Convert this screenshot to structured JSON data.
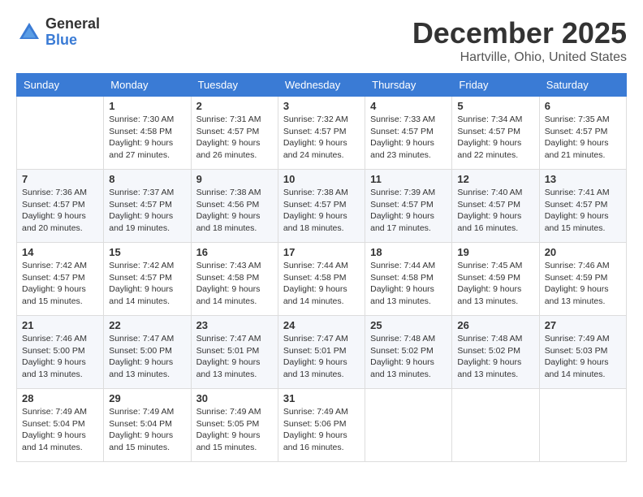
{
  "header": {
    "logo_general": "General",
    "logo_blue": "Blue",
    "title": "December 2025",
    "location": "Hartville, Ohio, United States"
  },
  "days_of_week": [
    "Sunday",
    "Monday",
    "Tuesday",
    "Wednesday",
    "Thursday",
    "Friday",
    "Saturday"
  ],
  "weeks": [
    [
      {
        "day": "",
        "sunrise": "",
        "sunset": "",
        "daylight": ""
      },
      {
        "day": "1",
        "sunrise": "Sunrise: 7:30 AM",
        "sunset": "Sunset: 4:58 PM",
        "daylight": "Daylight: 9 hours and 27 minutes."
      },
      {
        "day": "2",
        "sunrise": "Sunrise: 7:31 AM",
        "sunset": "Sunset: 4:57 PM",
        "daylight": "Daylight: 9 hours and 26 minutes."
      },
      {
        "day": "3",
        "sunrise": "Sunrise: 7:32 AM",
        "sunset": "Sunset: 4:57 PM",
        "daylight": "Daylight: 9 hours and 24 minutes."
      },
      {
        "day": "4",
        "sunrise": "Sunrise: 7:33 AM",
        "sunset": "Sunset: 4:57 PM",
        "daylight": "Daylight: 9 hours and 23 minutes."
      },
      {
        "day": "5",
        "sunrise": "Sunrise: 7:34 AM",
        "sunset": "Sunset: 4:57 PM",
        "daylight": "Daylight: 9 hours and 22 minutes."
      },
      {
        "day": "6",
        "sunrise": "Sunrise: 7:35 AM",
        "sunset": "Sunset: 4:57 PM",
        "daylight": "Daylight: 9 hours and 21 minutes."
      }
    ],
    [
      {
        "day": "7",
        "sunrise": "Sunrise: 7:36 AM",
        "sunset": "Sunset: 4:57 PM",
        "daylight": "Daylight: 9 hours and 20 minutes."
      },
      {
        "day": "8",
        "sunrise": "Sunrise: 7:37 AM",
        "sunset": "Sunset: 4:57 PM",
        "daylight": "Daylight: 9 hours and 19 minutes."
      },
      {
        "day": "9",
        "sunrise": "Sunrise: 7:38 AM",
        "sunset": "Sunset: 4:56 PM",
        "daylight": "Daylight: 9 hours and 18 minutes."
      },
      {
        "day": "10",
        "sunrise": "Sunrise: 7:38 AM",
        "sunset": "Sunset: 4:57 PM",
        "daylight": "Daylight: 9 hours and 18 minutes."
      },
      {
        "day": "11",
        "sunrise": "Sunrise: 7:39 AM",
        "sunset": "Sunset: 4:57 PM",
        "daylight": "Daylight: 9 hours and 17 minutes."
      },
      {
        "day": "12",
        "sunrise": "Sunrise: 7:40 AM",
        "sunset": "Sunset: 4:57 PM",
        "daylight": "Daylight: 9 hours and 16 minutes."
      },
      {
        "day": "13",
        "sunrise": "Sunrise: 7:41 AM",
        "sunset": "Sunset: 4:57 PM",
        "daylight": "Daylight: 9 hours and 15 minutes."
      }
    ],
    [
      {
        "day": "14",
        "sunrise": "Sunrise: 7:42 AM",
        "sunset": "Sunset: 4:57 PM",
        "daylight": "Daylight: 9 hours and 15 minutes."
      },
      {
        "day": "15",
        "sunrise": "Sunrise: 7:42 AM",
        "sunset": "Sunset: 4:57 PM",
        "daylight": "Daylight: 9 hours and 14 minutes."
      },
      {
        "day": "16",
        "sunrise": "Sunrise: 7:43 AM",
        "sunset": "Sunset: 4:58 PM",
        "daylight": "Daylight: 9 hours and 14 minutes."
      },
      {
        "day": "17",
        "sunrise": "Sunrise: 7:44 AM",
        "sunset": "Sunset: 4:58 PM",
        "daylight": "Daylight: 9 hours and 14 minutes."
      },
      {
        "day": "18",
        "sunrise": "Sunrise: 7:44 AM",
        "sunset": "Sunset: 4:58 PM",
        "daylight": "Daylight: 9 hours and 13 minutes."
      },
      {
        "day": "19",
        "sunrise": "Sunrise: 7:45 AM",
        "sunset": "Sunset: 4:59 PM",
        "daylight": "Daylight: 9 hours and 13 minutes."
      },
      {
        "day": "20",
        "sunrise": "Sunrise: 7:46 AM",
        "sunset": "Sunset: 4:59 PM",
        "daylight": "Daylight: 9 hours and 13 minutes."
      }
    ],
    [
      {
        "day": "21",
        "sunrise": "Sunrise: 7:46 AM",
        "sunset": "Sunset: 5:00 PM",
        "daylight": "Daylight: 9 hours and 13 minutes."
      },
      {
        "day": "22",
        "sunrise": "Sunrise: 7:47 AM",
        "sunset": "Sunset: 5:00 PM",
        "daylight": "Daylight: 9 hours and 13 minutes."
      },
      {
        "day": "23",
        "sunrise": "Sunrise: 7:47 AM",
        "sunset": "Sunset: 5:01 PM",
        "daylight": "Daylight: 9 hours and 13 minutes."
      },
      {
        "day": "24",
        "sunrise": "Sunrise: 7:47 AM",
        "sunset": "Sunset: 5:01 PM",
        "daylight": "Daylight: 9 hours and 13 minutes."
      },
      {
        "day": "25",
        "sunrise": "Sunrise: 7:48 AM",
        "sunset": "Sunset: 5:02 PM",
        "daylight": "Daylight: 9 hours and 13 minutes."
      },
      {
        "day": "26",
        "sunrise": "Sunrise: 7:48 AM",
        "sunset": "Sunset: 5:02 PM",
        "daylight": "Daylight: 9 hours and 13 minutes."
      },
      {
        "day": "27",
        "sunrise": "Sunrise: 7:49 AM",
        "sunset": "Sunset: 5:03 PM",
        "daylight": "Daylight: 9 hours and 14 minutes."
      }
    ],
    [
      {
        "day": "28",
        "sunrise": "Sunrise: 7:49 AM",
        "sunset": "Sunset: 5:04 PM",
        "daylight": "Daylight: 9 hours and 14 minutes."
      },
      {
        "day": "29",
        "sunrise": "Sunrise: 7:49 AM",
        "sunset": "Sunset: 5:04 PM",
        "daylight": "Daylight: 9 hours and 15 minutes."
      },
      {
        "day": "30",
        "sunrise": "Sunrise: 7:49 AM",
        "sunset": "Sunset: 5:05 PM",
        "daylight": "Daylight: 9 hours and 15 minutes."
      },
      {
        "day": "31",
        "sunrise": "Sunrise: 7:49 AM",
        "sunset": "Sunset: 5:06 PM",
        "daylight": "Daylight: 9 hours and 16 minutes."
      },
      {
        "day": "",
        "sunrise": "",
        "sunset": "",
        "daylight": ""
      },
      {
        "day": "",
        "sunrise": "",
        "sunset": "",
        "daylight": ""
      },
      {
        "day": "",
        "sunrise": "",
        "sunset": "",
        "daylight": ""
      }
    ]
  ],
  "accent_color": "#3a7bd5"
}
